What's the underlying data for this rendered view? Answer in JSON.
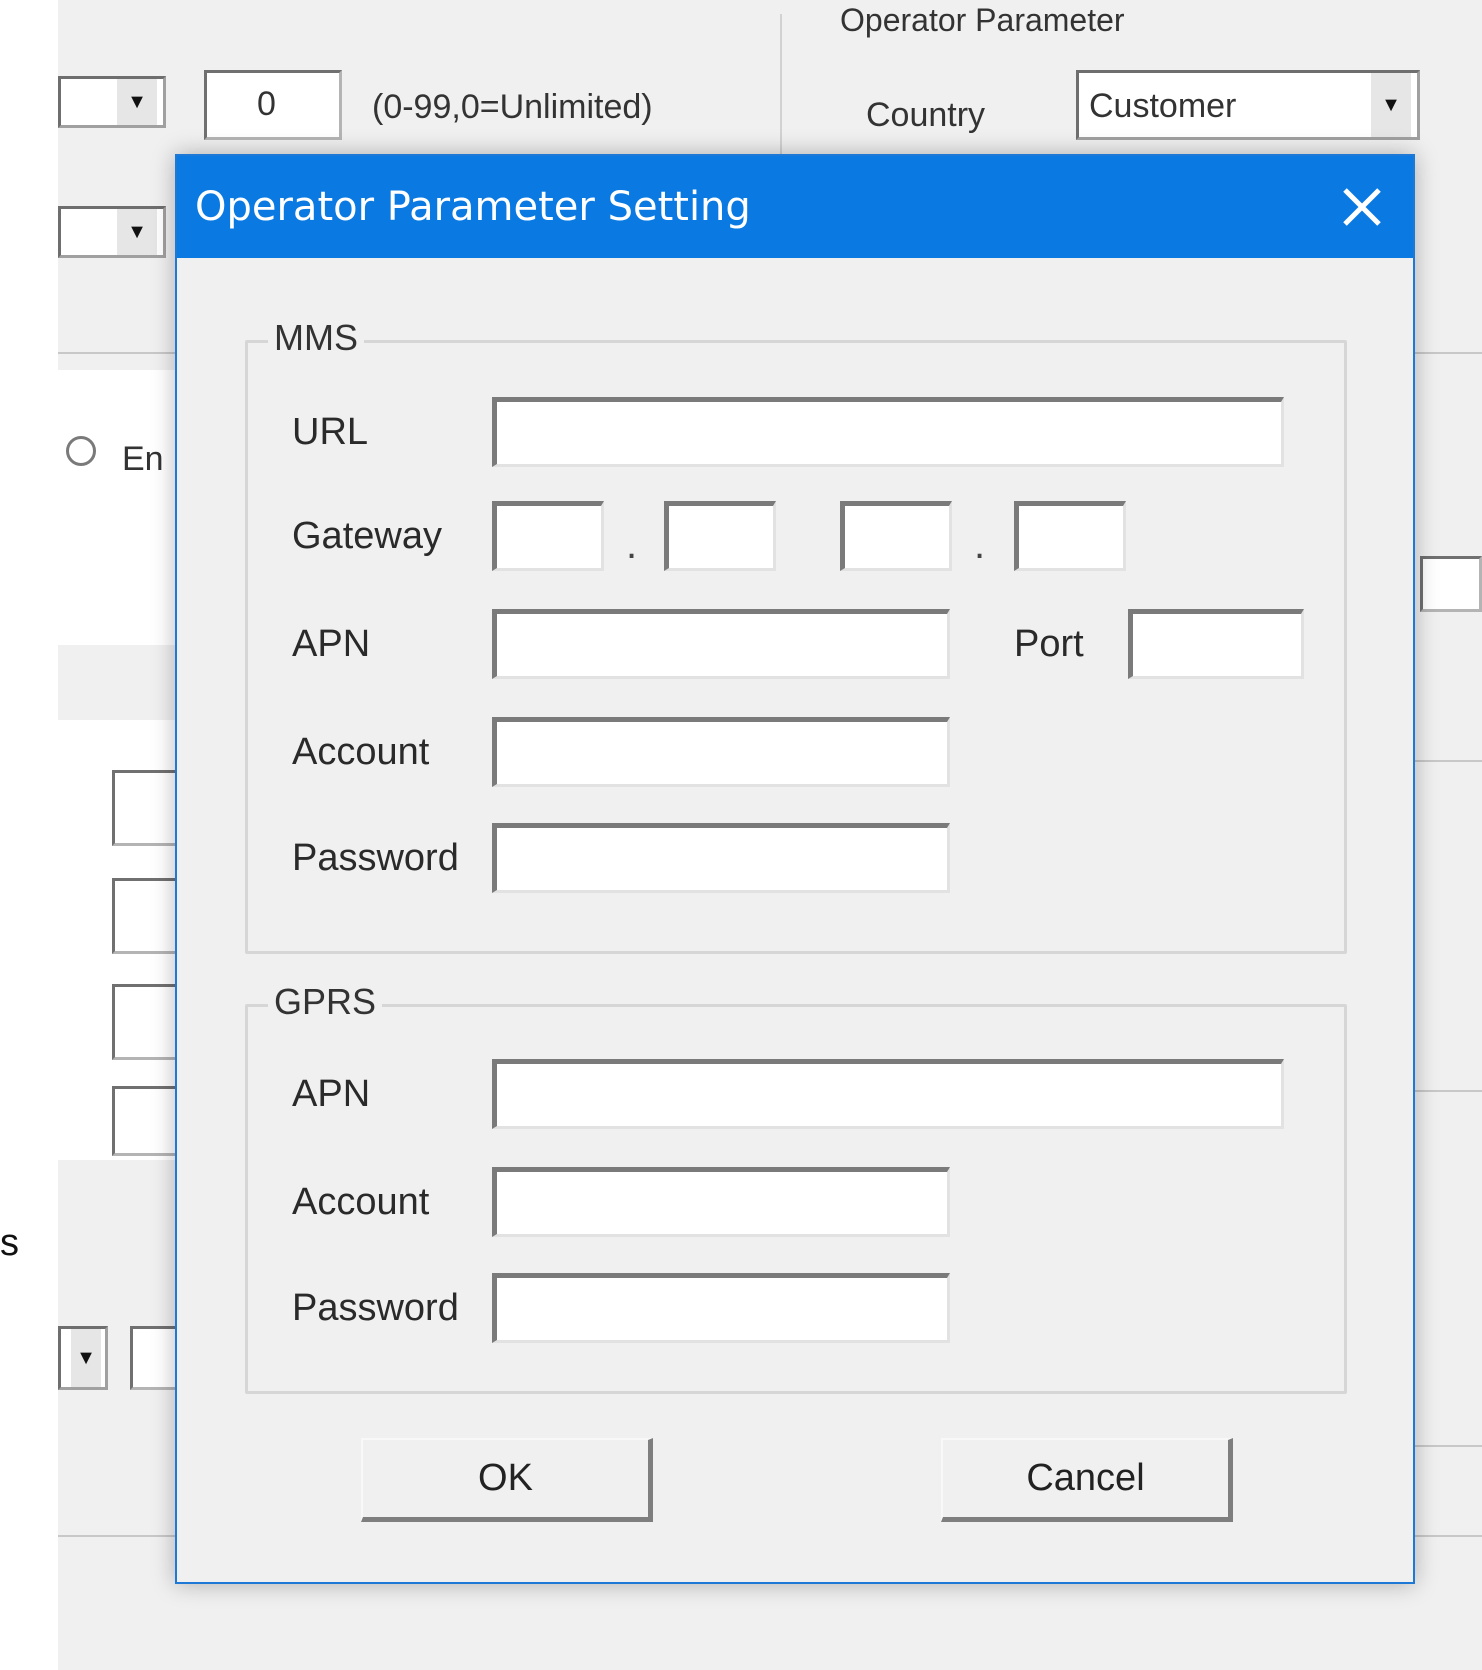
{
  "background": {
    "counter_value": "0",
    "counter_hint": "(0-99,0=Unlimited)",
    "group_title": "Operator Parameter",
    "country_label": "Country",
    "country_value": "Customer",
    "radio_partial_label": "En",
    "side_letter": "s"
  },
  "dialog": {
    "title": "Operator Parameter Setting",
    "mms": {
      "legend": "MMS",
      "url_label": "URL",
      "url_value": "",
      "gateway_label": "Gateway",
      "gateway_octets": [
        "",
        "",
        "",
        ""
      ],
      "apn_label": "APN",
      "apn_value": "",
      "port_label": "Port",
      "port_value": "",
      "account_label": "Account",
      "account_value": "",
      "password_label": "Password",
      "password_value": ""
    },
    "gprs": {
      "legend": "GPRS",
      "apn_label": "APN",
      "apn_value": "",
      "account_label": "Account",
      "account_value": "",
      "password_label": "Password",
      "password_value": ""
    },
    "ok_label": "OK",
    "cancel_label": "Cancel"
  },
  "icons": {
    "close": "close-icon",
    "dropdown": "chevron-down-icon"
  },
  "colors": {
    "titlebar": "#0a7ae2",
    "window_bg": "#f0f0f0",
    "title_text": "#ffffff"
  }
}
